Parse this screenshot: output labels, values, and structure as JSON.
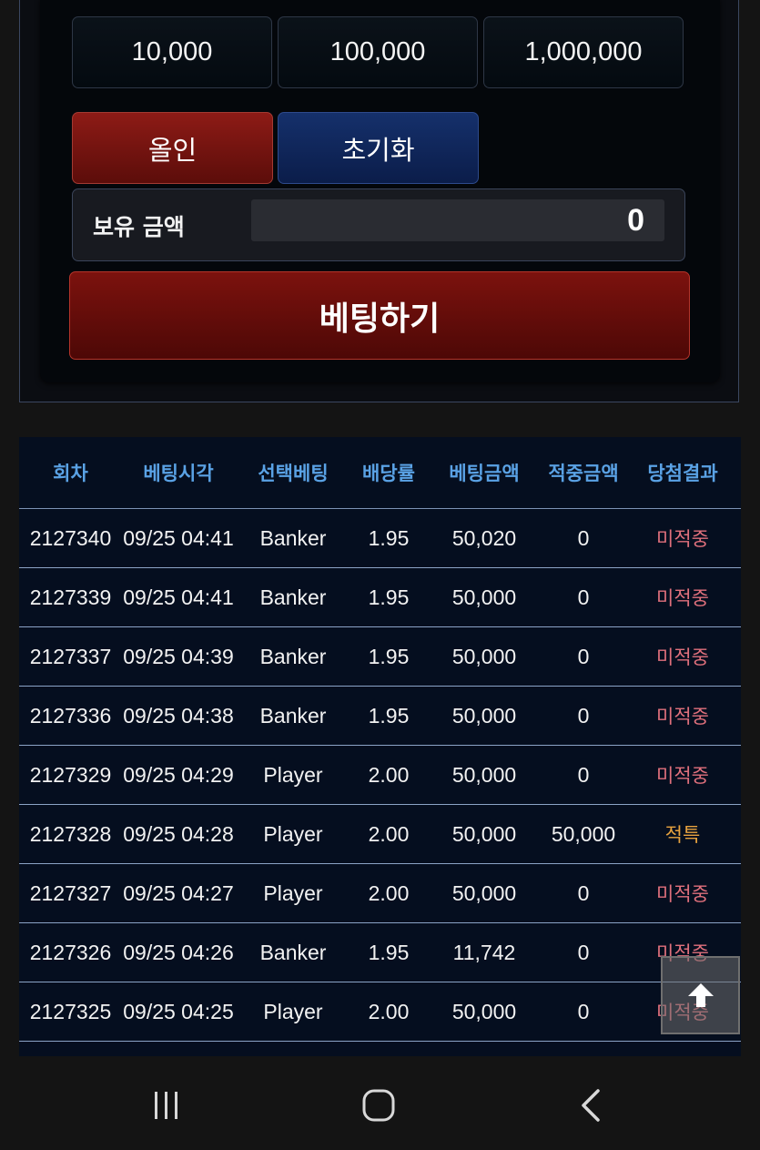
{
  "amount_chips": [
    "10,000",
    "100,000",
    "1,000,000"
  ],
  "actions": {
    "allin_label": "올인",
    "reset_label": "초기화"
  },
  "balance": {
    "label": "보유 금액",
    "value": "0"
  },
  "bet_button_label": "베팅하기",
  "history": {
    "columns": [
      "회차",
      "베팅시각",
      "선택베팅",
      "배당률",
      "베팅금액",
      "적중금액",
      "당첨결과"
    ],
    "rows": [
      [
        "2127340",
        "09/25 04:41",
        "Banker",
        "1.95",
        "50,020",
        "0",
        "미적중"
      ],
      [
        "2127339",
        "09/25 04:41",
        "Banker",
        "1.95",
        "50,000",
        "0",
        "미적중"
      ],
      [
        "2127337",
        "09/25 04:39",
        "Banker",
        "1.95",
        "50,000",
        "0",
        "미적중"
      ],
      [
        "2127336",
        "09/25 04:38",
        "Banker",
        "1.95",
        "50,000",
        "0",
        "미적중"
      ],
      [
        "2127329",
        "09/25 04:29",
        "Player",
        "2.00",
        "50,000",
        "0",
        "미적중"
      ],
      [
        "2127328",
        "09/25 04:28",
        "Player",
        "2.00",
        "50,000",
        "50,000",
        "적특"
      ],
      [
        "2127327",
        "09/25 04:27",
        "Player",
        "2.00",
        "50,000",
        "0",
        "미적중"
      ],
      [
        "2127326",
        "09/25 04:26",
        "Banker",
        "1.95",
        "11,742",
        "0",
        "미적중"
      ],
      [
        "2127325",
        "09/25 04:25",
        "Player",
        "2.00",
        "50,000",
        "0",
        "미적중"
      ]
    ]
  },
  "colors": {
    "header_text": "#5aa2e5",
    "result_lose": "#e0707c",
    "result_win": "#e8a33f",
    "allin_button": "#8d1b16",
    "reset_button": "#15306b"
  },
  "icons": {
    "scroll_top": "arrow-up-icon",
    "nav_recent": "recent-apps-icon",
    "nav_home": "home-icon",
    "nav_back": "back-icon"
  }
}
